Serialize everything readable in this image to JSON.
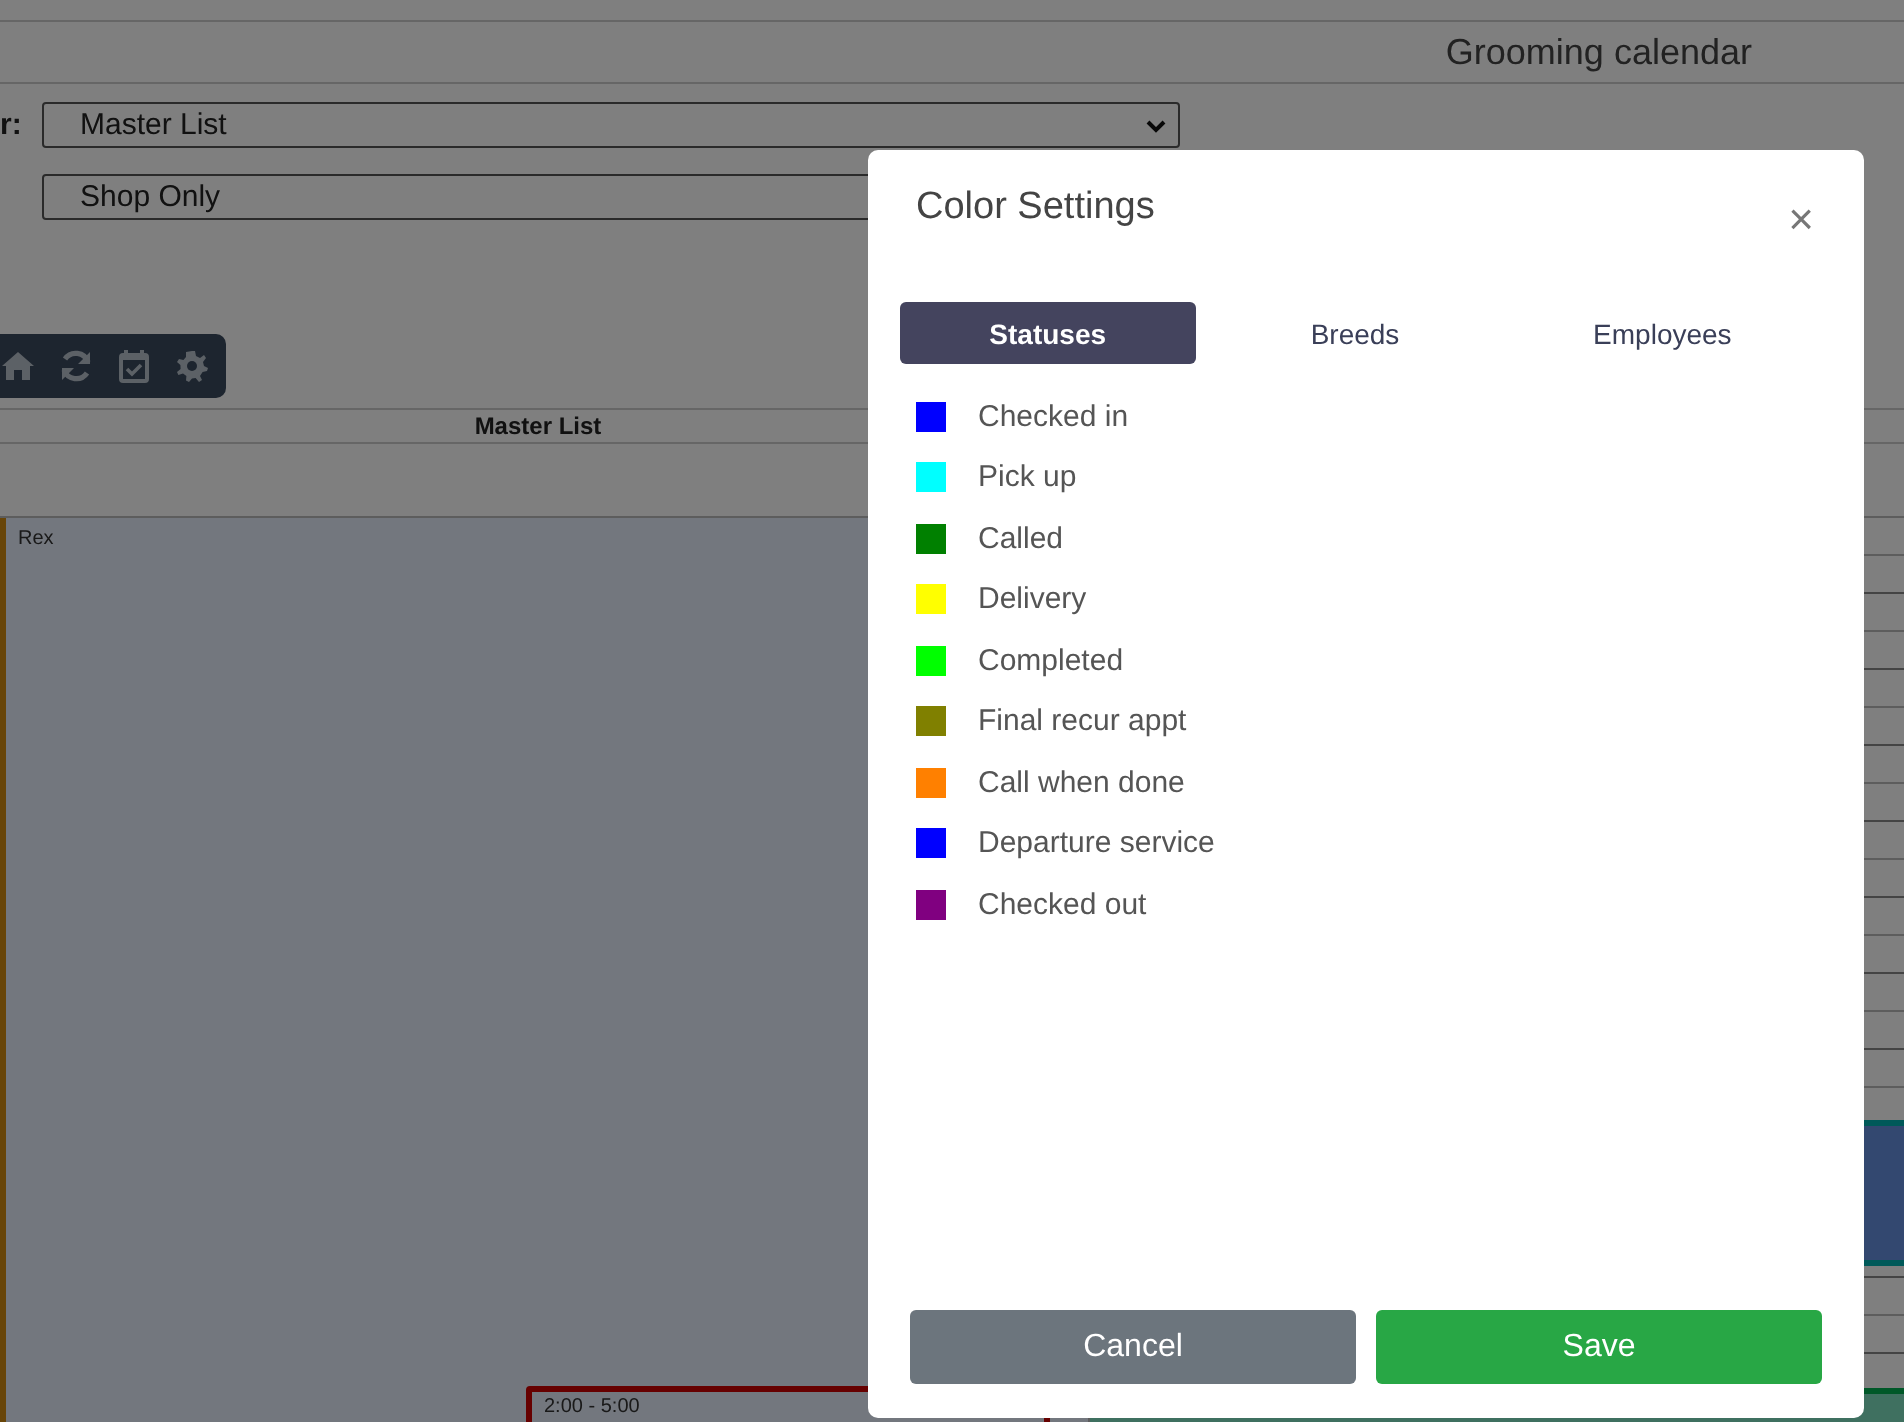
{
  "page": {
    "title": "Grooming calendar",
    "filters": [
      {
        "label": "r:",
        "value": "Master List"
      },
      {
        "value": "Shop Only"
      }
    ],
    "column_header": "Master List",
    "row_label": "Rex",
    "appointment": {
      "time": "2:00 - 5:00"
    }
  },
  "dialog": {
    "title": "Color Settings",
    "close": "×",
    "tabs": [
      {
        "label": "Statuses",
        "selected": true
      },
      {
        "label": "Breeds",
        "selected": false
      },
      {
        "label": "Employees",
        "selected": false
      }
    ],
    "statuses": [
      {
        "name": "Checked in",
        "color": "#0000ff"
      },
      {
        "name": "Pick up",
        "color": "#00ffff"
      },
      {
        "name": "Called",
        "color": "#008000"
      },
      {
        "name": "Delivery",
        "color": "#ffff00"
      },
      {
        "name": "Completed",
        "color": "#00ff00"
      },
      {
        "name": "Final recur appt",
        "color": "#808000"
      },
      {
        "name": "Call when done",
        "color": "#ff8000"
      },
      {
        "name": "Departure service",
        "color": "#0000ff"
      },
      {
        "name": "Checked out",
        "color": "#800080"
      }
    ],
    "buttons": [
      {
        "label": "Cancel",
        "kind": "secondary"
      },
      {
        "label": "Save",
        "kind": "primary"
      }
    ]
  }
}
